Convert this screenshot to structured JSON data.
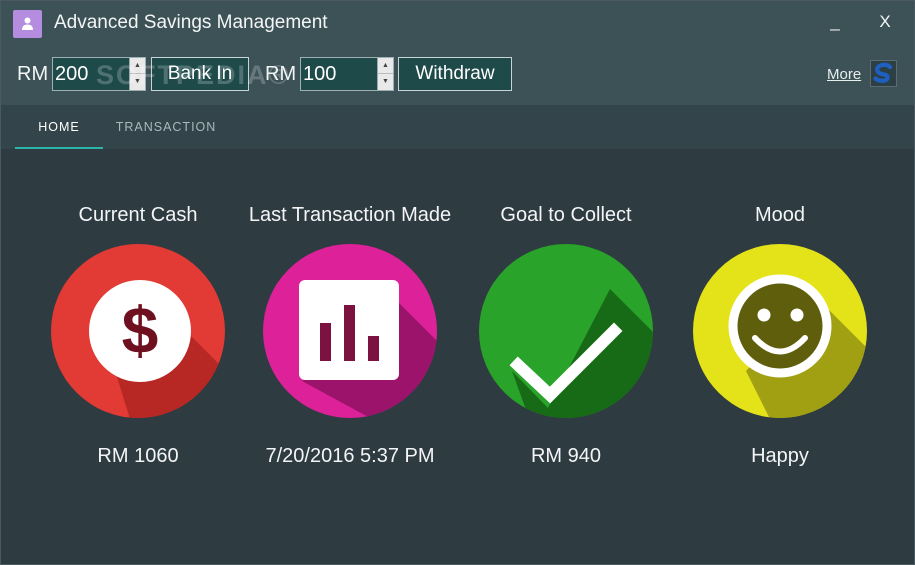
{
  "window": {
    "title": "Advanced Savings Management",
    "minimize_label": "_",
    "close_label": "X"
  },
  "toolbar": {
    "currency_label": "RM",
    "deposit_amount": "200",
    "bank_in_label": "Bank In",
    "withdraw_currency_label": "RM",
    "withdraw_amount": "100",
    "withdraw_label": "Withdraw",
    "more_label": "More",
    "watermark": "SOFTPEDIA®"
  },
  "tabs": [
    {
      "label": "HOME",
      "active": true
    },
    {
      "label": "TRANSACTION",
      "active": false
    }
  ],
  "cards": [
    {
      "title": "Current Cash",
      "value": "RM 1060",
      "color": "#e23a35",
      "icon": "dollar-icon"
    },
    {
      "title": "Last Transaction Made",
      "value": "7/20/2016 5:37 PM",
      "color": "#dd2198",
      "icon": "bar-chart-icon"
    },
    {
      "title": "Goal to Collect",
      "value": "RM 940",
      "color": "#29a329",
      "icon": "checkmark-icon"
    },
    {
      "title": "Mood",
      "value": "Happy",
      "color": "#e4e31a",
      "icon": "smiley-icon"
    }
  ],
  "colors": {
    "background": "#2e3b40",
    "titlebar": "#3c5256",
    "tab_accent": "#2bb5a8"
  }
}
